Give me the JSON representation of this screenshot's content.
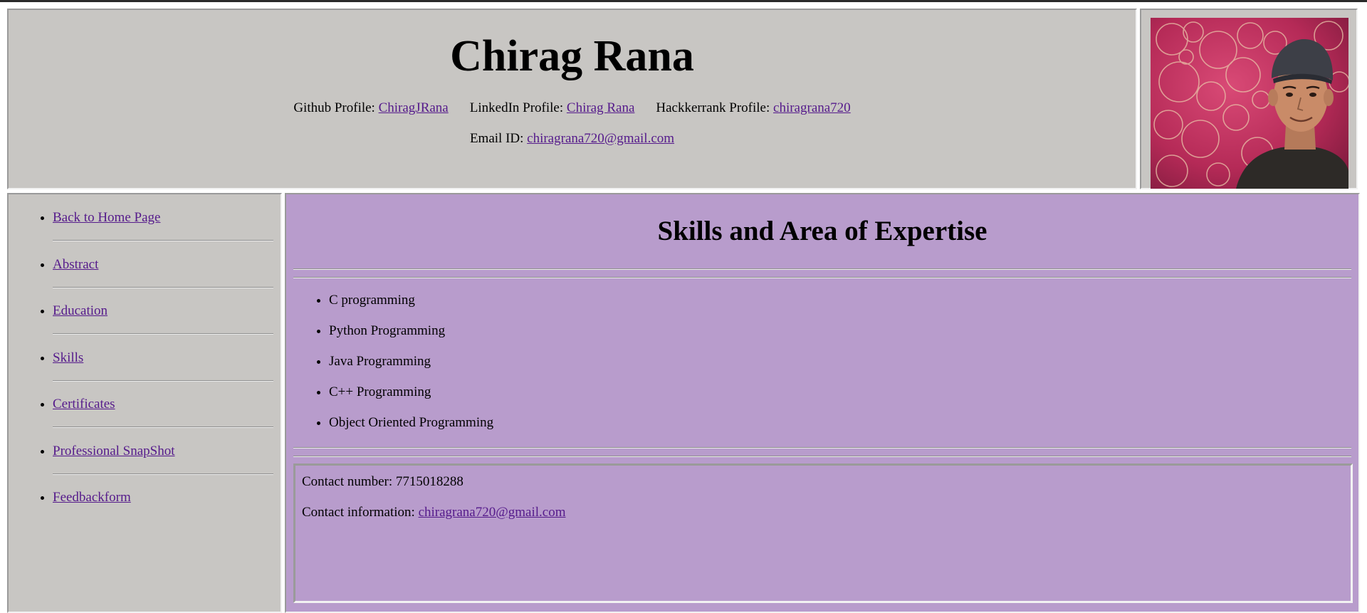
{
  "header": {
    "name": "Chirag Rana",
    "github_label": "Github Profile:",
    "github_link": "ChiragJRana",
    "linkedin_label": "LinkedIn Profile:",
    "linkedin_link": "Chirag Rana",
    "hackerrank_label": "Hackkerrank Profile:",
    "hackerrank_link": "chiragrana720",
    "email_label": "Email ID:",
    "email_link": "chiragrana720@gmail.com"
  },
  "sidebar": {
    "items": [
      {
        "label": "Back to Home Page"
      },
      {
        "label": "Abstract"
      },
      {
        "label": "Education"
      },
      {
        "label": "Skills"
      },
      {
        "label": "Certificates"
      },
      {
        "label": "Professional SnapShot"
      },
      {
        "label": "Feedbackform"
      }
    ]
  },
  "main": {
    "title": "Skills and Area of Expertise",
    "skills": [
      "C programming",
      "Python Programming",
      "Java Programming",
      "C++ Programming",
      "Object Oriented Programming"
    ],
    "contact_number_label": "Contact number:",
    "contact_number": "7715018288",
    "contact_info_label": "Contact information:",
    "contact_info_link": "chiragrana720@gmail.com"
  },
  "colors": {
    "panel_gray": "#c8c6c3",
    "main_purple": "#b89ccc",
    "link_visited": "#551a8b",
    "photo_background": "#c0325f"
  },
  "icons": {
    "photo": "profile-photo"
  }
}
